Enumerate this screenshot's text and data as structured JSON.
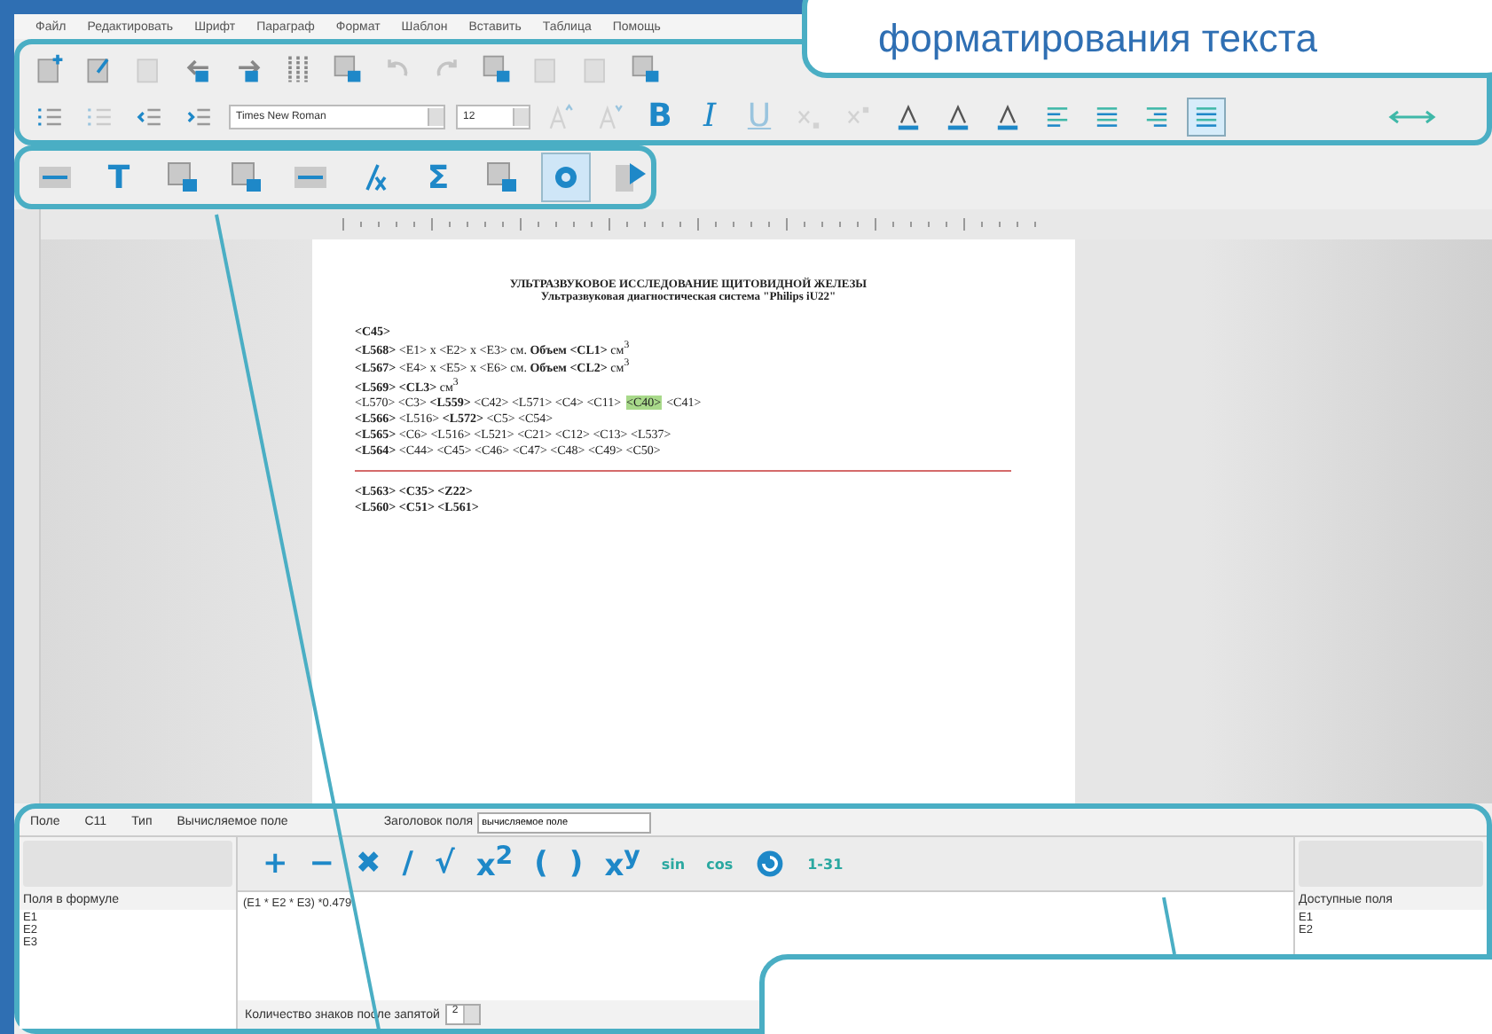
{
  "callout_top": {
    "text": "форматирования текста"
  },
  "menu": [
    "Файл",
    "Редактировать",
    "Шрифт",
    "Параграф",
    "Формат",
    "Шаблон",
    "Вставить",
    "Таблица",
    "Помощь"
  ],
  "toolbar_main": [
    {
      "kind": "new-doc",
      "disabled": false
    },
    {
      "kind": "edit-doc",
      "disabled": false
    },
    {
      "kind": "doc",
      "disabled": true
    },
    {
      "kind": "move-left",
      "disabled": false
    },
    {
      "kind": "move-right",
      "disabled": false
    },
    {
      "kind": "columns",
      "disabled": false
    },
    {
      "kind": "doc-lock",
      "disabled": false
    },
    {
      "kind": "undo",
      "disabled": true
    },
    {
      "kind": "redo",
      "disabled": true
    },
    {
      "kind": "doc-lock",
      "disabled": false
    },
    {
      "kind": "doc",
      "disabled": true
    },
    {
      "kind": "doc",
      "disabled": true
    },
    {
      "kind": "doc-lock",
      "disabled": false
    }
  ],
  "format_bar": {
    "before": [
      {
        "kind": "list-number",
        "disabled": false
      },
      {
        "kind": "list-bullet",
        "disabled": true
      },
      {
        "kind": "indent-less",
        "disabled": false
      },
      {
        "kind": "indent-more",
        "disabled": false
      }
    ],
    "font": "Times New Roman",
    "size": "12",
    "after": [
      {
        "kind": "grow-font",
        "disabled": true
      },
      {
        "kind": "shrink-font",
        "disabled": true
      },
      {
        "kind": "bold",
        "label": "B",
        "disabled": false
      },
      {
        "kind": "italic",
        "label": "I",
        "disabled": false
      },
      {
        "kind": "underline",
        "label": "U",
        "disabled": true
      },
      {
        "kind": "subscript",
        "disabled": true
      },
      {
        "kind": "superscript",
        "disabled": true
      },
      {
        "kind": "font-color",
        "disabled": false
      },
      {
        "kind": "highlight",
        "disabled": false
      },
      {
        "kind": "fill",
        "disabled": false
      },
      {
        "kind": "align-left",
        "selected": false
      },
      {
        "kind": "align-center",
        "selected": false
      },
      {
        "kind": "align-right",
        "selected": false
      },
      {
        "kind": "align-justify",
        "selected": true
      }
    ]
  },
  "insert_bar": [
    {
      "kind": "field-tag",
      "selected": false
    },
    {
      "kind": "text",
      "label": "T",
      "selected": false
    },
    {
      "kind": "doc-lock",
      "selected": false
    },
    {
      "kind": "doc-lock",
      "selected": false
    },
    {
      "kind": "field-tag",
      "selected": false
    },
    {
      "kind": "formula",
      "selected": false
    },
    {
      "kind": "text",
      "label": "Σ",
      "selected": false
    },
    {
      "kind": "doc-lock",
      "selected": false
    },
    {
      "kind": "gear",
      "selected": true
    },
    {
      "kind": "play",
      "selected": false
    }
  ],
  "document": {
    "title": "УЛЬТРАЗВУКОВОЕ ИССЛЕДОВАНИЕ ЩИТОВИДНОЙ ЖЕЛЕЗЫ",
    "subtitle": "Ультразвуковая диагностическая система \"Philips iU22\"",
    "lines": [
      {
        "kind": "text",
        "parts": [
          {
            "text": "**<C45>**",
            "highlighted": false
          }
        ]
      },
      {
        "kind": "text",
        "parts": [
          {
            "text": "**<L568>** <E1> x <E2> x <E3> см. **Объем <CL1>** см$^{3}$",
            "highlighted": false
          }
        ]
      },
      {
        "kind": "text",
        "parts": [
          {
            "text": "**<L567>** <E4> x <E5> x <E6> см. **Объем <CL2>** см$^{3}$",
            "highlighted": false
          }
        ]
      },
      {
        "kind": "text",
        "parts": [
          {
            "text": "**<L569> <CL3>** см$^{3}$",
            "highlighted": false
          }
        ]
      },
      {
        "kind": "text",
        "parts": [
          {
            "text": "<L570> <C3> **<L559>** <C42> <L571> <C4> <C11>",
            "highlighted": false
          },
          {
            "text": "<C40>",
            "highlighted": true
          },
          {
            "text": "<C41>",
            "highlighted": false
          }
        ]
      },
      {
        "kind": "text",
        "parts": [
          {
            "text": "**<L566>** <L516> **<L572>** <C5> <C54>",
            "highlighted": false
          }
        ]
      },
      {
        "kind": "text",
        "parts": [
          {
            "text": "**<L565>** <C6> <L516> <L521> <C21> <C12> <C13> <L537>",
            "highlighted": false
          }
        ]
      },
      {
        "kind": "text",
        "parts": [
          {
            "text": "**<L564>** <C44> <C45> <C46> <C47> <C48> <C49> <C50>",
            "highlighted": false
          }
        ]
      },
      {
        "kind": "rule"
      },
      {
        "kind": "text",
        "parts": [
          {
            "text": "**<L563> <C35> <Z22>**",
            "highlighted": false
          }
        ]
      },
      {
        "kind": "text",
        "parts": [
          {
            "text": "**<L560> <C51> <L561>**",
            "highlighted": false
          }
        ]
      }
    ]
  },
  "field_panel": {
    "field_label": "Поле",
    "field_value": "C11",
    "type_label": "Тип",
    "type_value": "Вычисляемое поле",
    "title_label": "Заголовок поля",
    "title_value": "вычисляемое поле",
    "operators": [
      {
        "kind": "text",
        "label": "+"
      },
      {
        "kind": "text",
        "label": "−"
      },
      {
        "kind": "text",
        "label": "✖"
      },
      {
        "kind": "text",
        "label": "/"
      },
      {
        "kind": "text",
        "label": "√"
      },
      {
        "kind": "text",
        "label": "x$^{2}$"
      },
      {
        "kind": "text",
        "label": "("
      },
      {
        "kind": "text",
        "label": ")"
      },
      {
        "kind": "text",
        "label": "x$^{y}$"
      },
      {
        "kind": "small",
        "label": "sin"
      },
      {
        "kind": "small",
        "label": "cos"
      },
      {
        "kind": "refresh"
      },
      {
        "kind": "small",
        "label": "1-31"
      }
    ],
    "formula_fields_label": "Поля в формуле",
    "formula_fields": [
      "E1",
      "E2",
      "E3"
    ],
    "formula": "(E1 * E2 * E3) *0.479",
    "decimals_label": "Количество знаков после запятой",
    "decimals": "2",
    "available_label": "Доступные поля",
    "available_fields": [
      "E1",
      "E2"
    ]
  }
}
